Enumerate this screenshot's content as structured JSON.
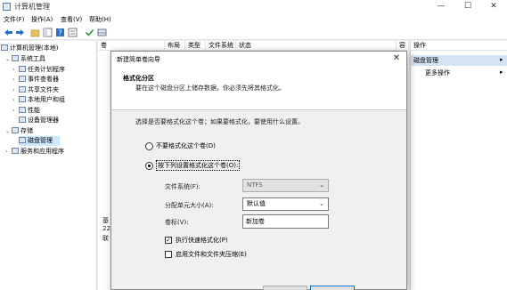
{
  "window": {
    "title": "计算机管理",
    "minimize": "—",
    "maximize": "☐",
    "close": "✕"
  },
  "menu": [
    "文件(F)",
    "操作(A)",
    "查看(V)",
    "帮助(H)"
  ],
  "toolbar": [
    "back-icon",
    "forward-icon",
    "up-folder-icon",
    "show-hide-tree-icon",
    "help-icon",
    "properties-icon",
    "check-icon",
    "disk-icon"
  ],
  "tree": {
    "root": "计算机管理(本地)",
    "system_tools": "系统工具",
    "task_scheduler": "任务计划程序",
    "event_viewer": "事件查看器",
    "shared_folders": "共享文件夹",
    "local_users": "本地用户和组",
    "performance": "性能",
    "device_manager": "设备管理器",
    "storage": "存储",
    "disk_management": "磁盘管理",
    "services_apps": "服务和应用程序"
  },
  "columns": [
    "卷",
    "布局",
    "类型",
    "文件系统",
    "状态",
    "容"
  ],
  "disk_info": {
    "label": "基",
    "size": "22",
    "status": "联"
  },
  "actions": {
    "header": "操作",
    "section": "磁盘管理",
    "more": "更多操作",
    "arrow": "▸"
  },
  "wizard": {
    "title": "新建简单卷向导",
    "close": "✕",
    "heading": "格式化分区",
    "subheading": "要在这个磁盘分区上储存数据，你必须先将其格式化。",
    "prompt": "选择是否要格式化这个卷；如果要格式化，要使用什么设置。",
    "option_no_format": "不要格式化这个卷(D)",
    "option_format": "按下列设置格式化这个卷(O):",
    "file_system_label": "文件系统(F):",
    "file_system_value": "NTFS",
    "alloc_unit_label": "分配单元大小(A):",
    "alloc_unit_value": "默认值",
    "volume_label_label": "卷标(V):",
    "volume_label_value": "新加卷",
    "quick_format_label": "执行快速格式化(P)",
    "quick_format_checked": "✓",
    "compression_label": "启用文件和文件夹压缩(E)"
  }
}
